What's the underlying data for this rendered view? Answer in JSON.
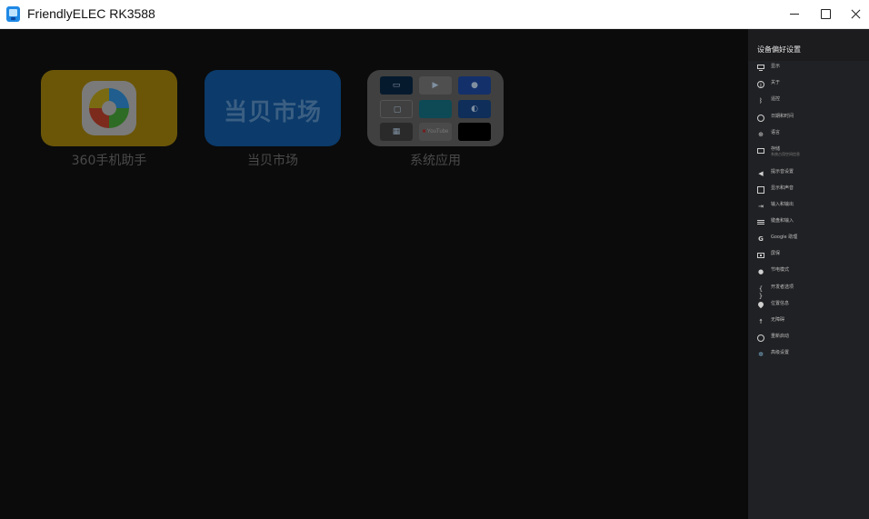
{
  "window": {
    "title": "FriendlyELEC RK3588"
  },
  "launcher": {
    "apps": [
      {
        "label": "360手机助手"
      },
      {
        "label": "当贝市场",
        "logo_text": "当贝市场"
      },
      {
        "label": "系统应用"
      }
    ],
    "system_folder": {
      "youtube_label": "YouTube"
    }
  },
  "settings_panel": {
    "title": "设备偏好设置",
    "items": [
      {
        "label": "显示",
        "icon": "display-icon"
      },
      {
        "label": "关于",
        "icon": "info-icon"
      },
      {
        "label": "遥控",
        "icon": "bluetooth-icon"
      },
      {
        "label": "日期和时间",
        "icon": "clock-icon"
      },
      {
        "label": "语言",
        "icon": "globe-icon"
      },
      {
        "label": "存储",
        "sublabel": "系统占用空间信息",
        "icon": "storage-icon"
      },
      {
        "label": "提示音设置",
        "icon": "sound-icon"
      },
      {
        "label": "显示和声音",
        "icon": "picture-icon"
      },
      {
        "label": "输入和输出",
        "icon": "input-icon"
      },
      {
        "label": "键盘和输入",
        "icon": "keyboard-icon"
      },
      {
        "label": "Google 助理",
        "icon": "google-icon"
      },
      {
        "label": "屏保",
        "icon": "screensaver-icon"
      },
      {
        "label": "节电模式",
        "icon": "lightbulb-icon"
      },
      {
        "label": "开发者选项",
        "icon": "developer-icon"
      },
      {
        "label": "位置信息",
        "icon": "location-icon"
      },
      {
        "label": "无障碍",
        "icon": "accessibility-icon"
      },
      {
        "label": "重新启动",
        "icon": "power-icon"
      },
      {
        "label": "高级设置",
        "icon": "gear-icon"
      }
    ]
  }
}
